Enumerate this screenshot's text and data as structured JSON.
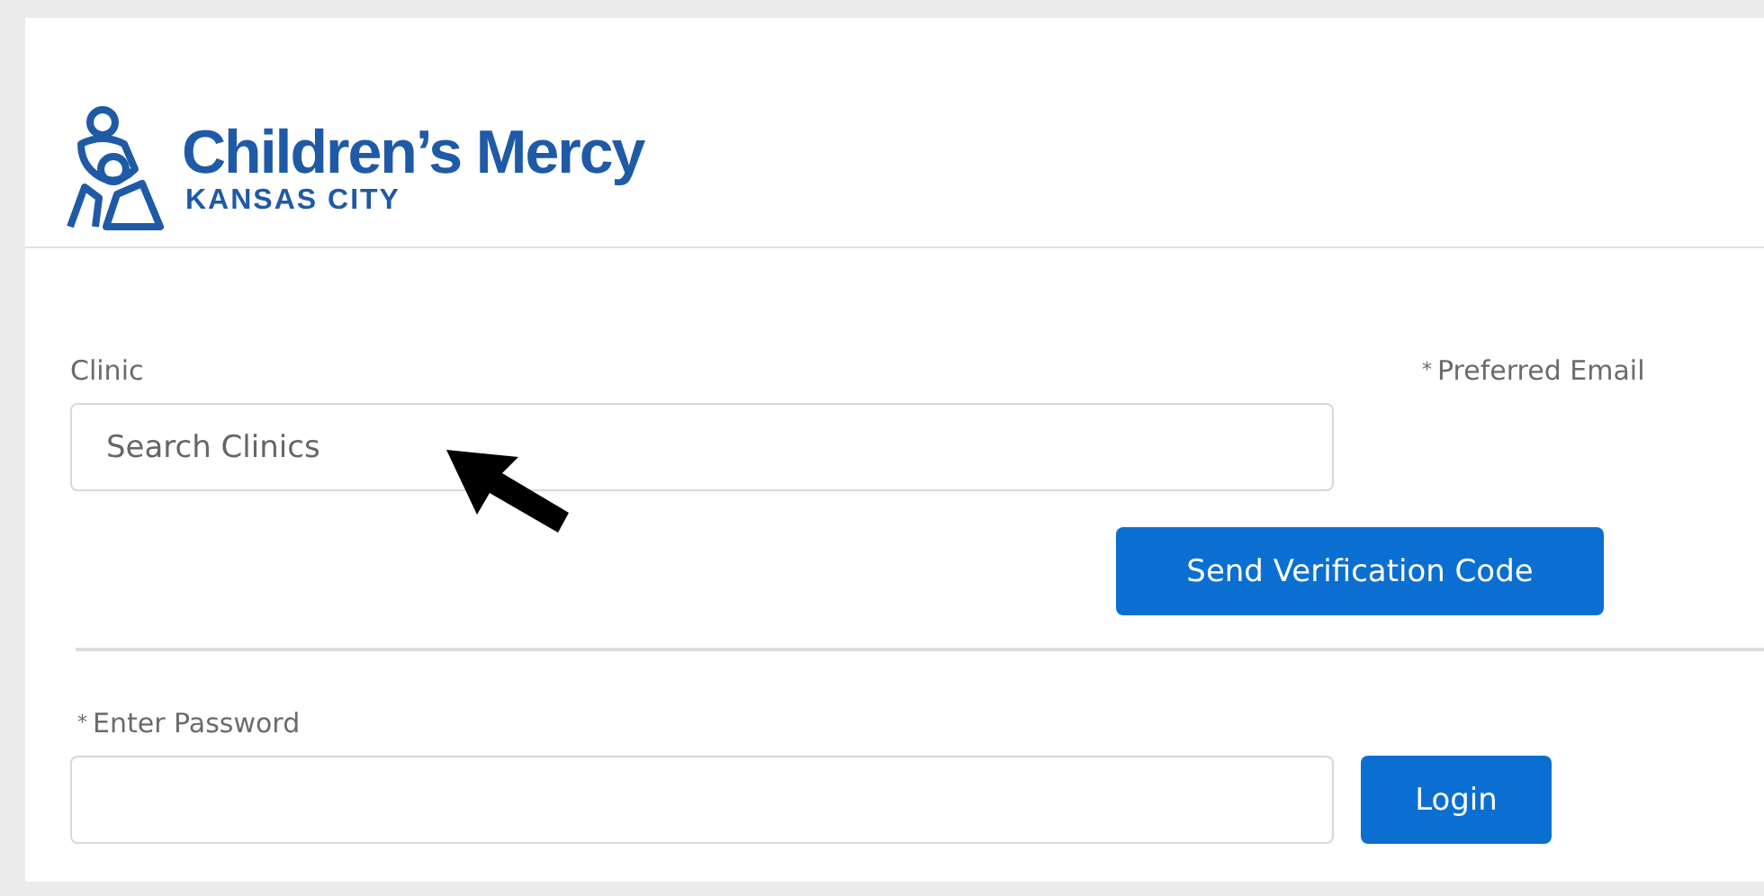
{
  "logo": {
    "name": "Children’s Mercy",
    "subtitle": "KANSAS CITY"
  },
  "clinic": {
    "label": "Clinic",
    "placeholder": "Search Clinics"
  },
  "email": {
    "required_mark": "*",
    "label": "Preferred Email"
  },
  "send_button": "Send Verification Code",
  "password": {
    "required_mark": "*",
    "label": "Enter Password"
  },
  "login_button": "Login"
}
